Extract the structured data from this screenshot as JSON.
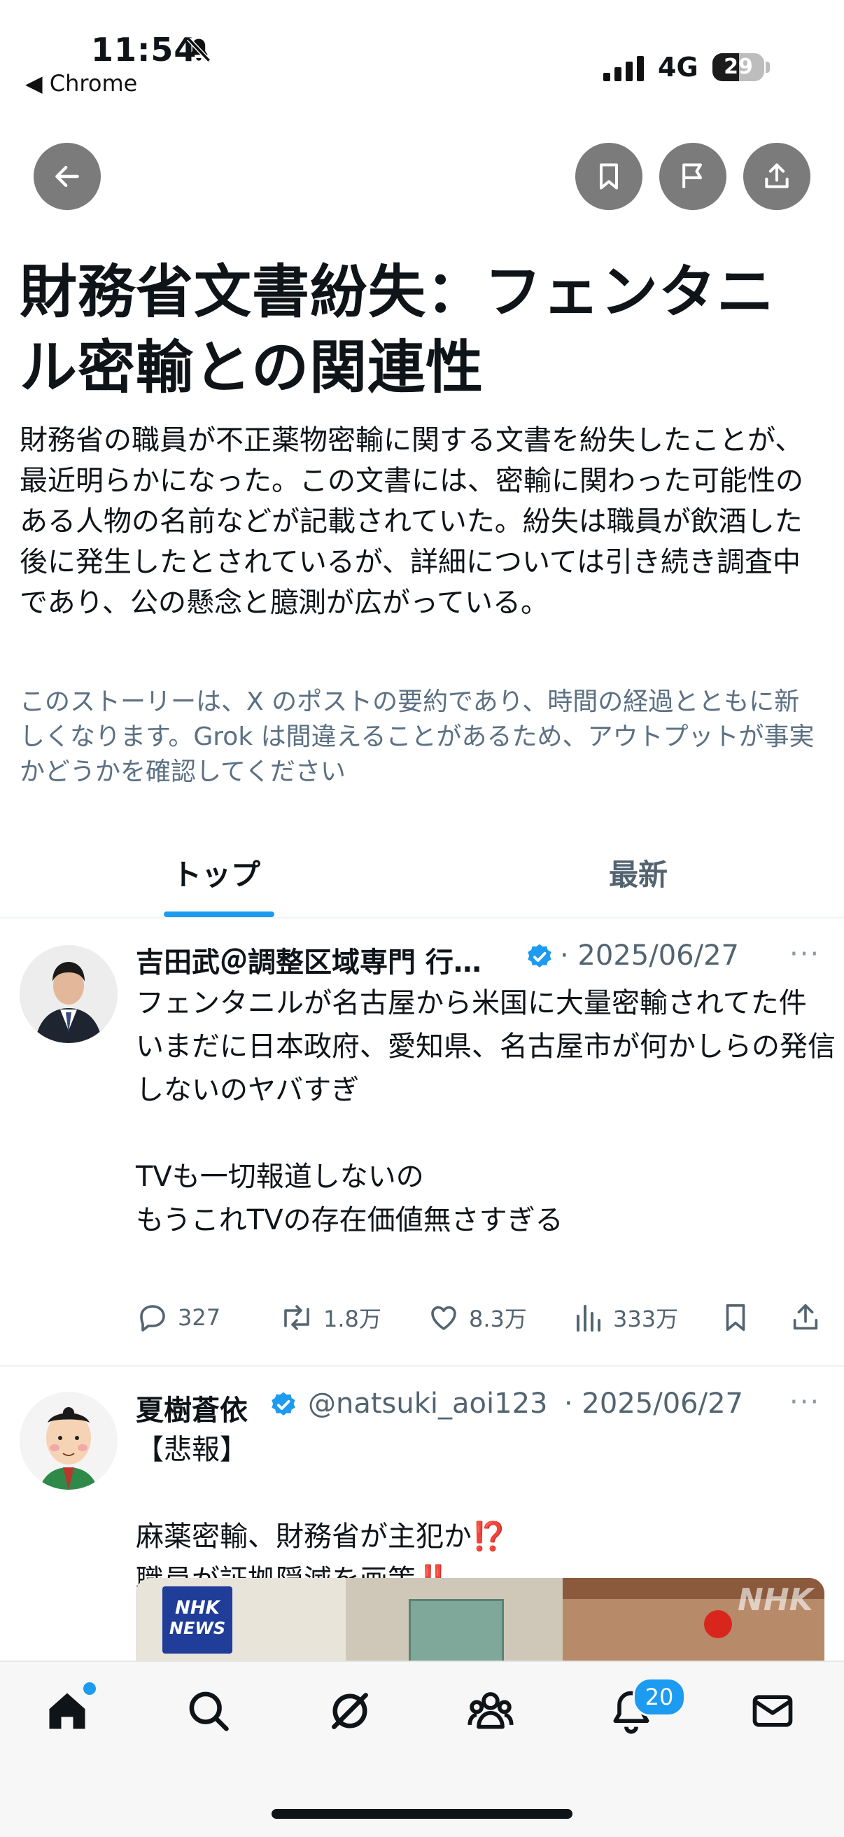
{
  "status_bar": {
    "time": "11:54",
    "back_app": "◀ Chrome",
    "network": "4G",
    "battery": "29"
  },
  "header_buttons": [
    "back-icon",
    "bookmark-icon",
    "flag-icon",
    "share-icon"
  ],
  "story": {
    "title": "財務省文書紛失：フェンタニル密輸との関連性",
    "summary": "財務省の職員が不正薬物密輸に関する文書を紛失したことが、最近明らかになった。この文書には、密輸に関わった可能性のある人物の名前などが記載されていた。紛失は職員が飲酒した後に発生したとされているが、詳細については引き続き調査中であり、公の懸念と臆測が広がっている。",
    "disclaimer": "このストーリーは、X のポストの要約であり、時間の経過とともに新しくなります。Grok は間違えることがあるため、アウトプットが事実かどうかを確認してください"
  },
  "tabs": [
    {
      "label": "トップ",
      "active": true
    },
    {
      "label": "最新",
      "active": false
    }
  ],
  "posts": [
    {
      "name": "吉田武＠調整区域専門 行…",
      "verified": true,
      "date": "· 2025/06/27",
      "text": "フェンタニルが名古屋から米国に大量密輸されてた件\nいまだに日本政府、愛知県、名古屋市が何かしらの発信しないのヤバすぎ\n\nTVも一切報道しないの\nもうこれTVの存在価値無さすぎる",
      "replies": "327",
      "reposts": "1.8万",
      "likes": "8.3万",
      "views": "333万"
    },
    {
      "name": "夏樹蒼依",
      "verified": true,
      "handle": "@natsuki_aoi123",
      "date": "· 2025/06/27",
      "line1": "【悲報】",
      "line2": "麻薬密輸、財務省が主犯か",
      "line2_emoji": "⁉️",
      "line3": "職員が証拠隠滅を画策",
      "line3_emoji": "‼️",
      "media_logo_top": "NHK",
      "media_logo_bottom": "NEWS",
      "media_watermark": "NHK"
    }
  ],
  "bottom_nav": {
    "items": [
      "home-icon",
      "search-icon",
      "grok-icon",
      "communities-icon",
      "notifications-icon",
      "messages-icon"
    ],
    "notification_count": "20"
  },
  "colors": {
    "accent": "#1d9bf0",
    "button_gray": "#7b7b7b",
    "secondary_text": "#536471"
  }
}
